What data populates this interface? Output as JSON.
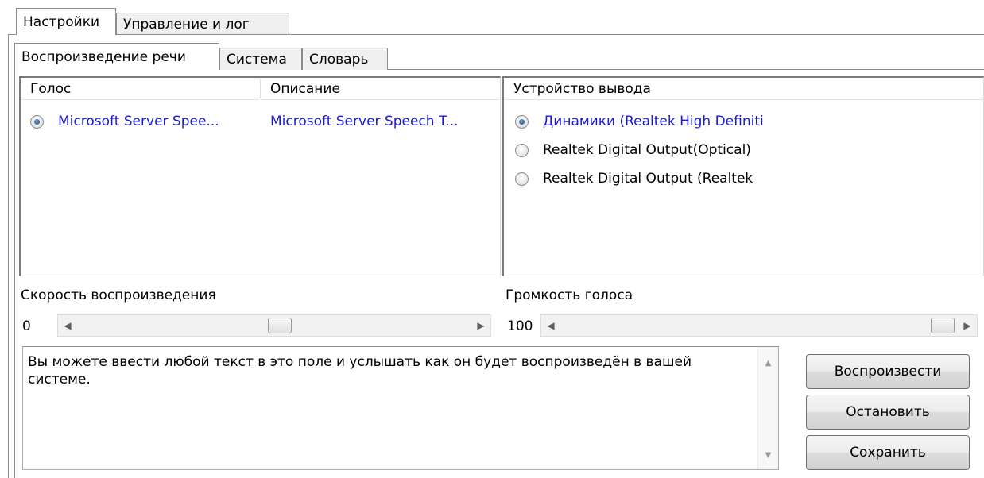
{
  "tabs": {
    "main": [
      "Настройки",
      "Управление и лог"
    ],
    "sub": [
      "Воспроизведение речи",
      "Система",
      "Словарь"
    ]
  },
  "voices": {
    "headers": {
      "voice": "Голос",
      "description": "Описание"
    },
    "items": [
      {
        "voice": "Microsoft Server Spee...",
        "description": "Microsoft Server Speech T...",
        "selected": true
      }
    ]
  },
  "devices": {
    "header": "Устройство вывода",
    "items": [
      {
        "label": "Динамики (Realtek High Definiti",
        "selected": true
      },
      {
        "label": "Realtek Digital Output(Optical)",
        "selected": false
      },
      {
        "label": "Realtek Digital Output (Realtek",
        "selected": false
      }
    ]
  },
  "speed": {
    "label": "Скорость воспроизведения",
    "value": "0"
  },
  "volume": {
    "label": "Громкость голоса",
    "value": "100"
  },
  "sample_text": "Вы можете ввести любой текст в это поле и услышать как он будет воспроизведён в вашей системе.",
  "buttons": {
    "play": "Воспроизвести",
    "stop": "Остановить",
    "save": "Сохранить"
  },
  "colors": {
    "selected_text": "#1a1ad6"
  }
}
